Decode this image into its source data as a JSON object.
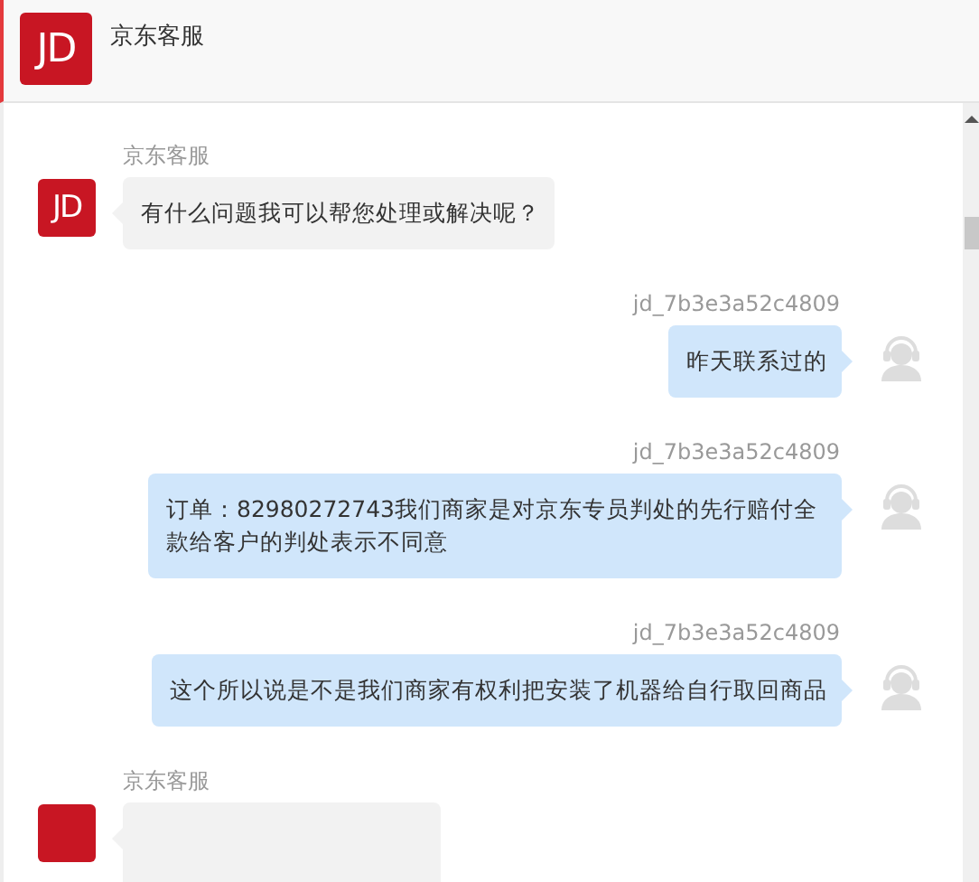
{
  "header": {
    "logo": "JD",
    "title": "京东客服"
  },
  "messages": [
    {
      "kind": "agent",
      "sender": "京东客服",
      "avatar": "JD",
      "text": "有什么问题我可以帮您处理或解决呢？"
    },
    {
      "kind": "user",
      "sender": "jd_7b3e3a52c4809",
      "text": "昨天联系过的"
    },
    {
      "kind": "user",
      "sender": "jd_7b3e3a52c4809",
      "text": "订单：82980272743我们商家是对京东专员判处的先行赔付全款给客户的判处表示不同意"
    },
    {
      "kind": "user",
      "sender": "jd_7b3e3a52c4809",
      "text": "这个所以说是不是我们商家有权利把安装了机器给自行取回商品"
    },
    {
      "kind": "agent",
      "sender": "京东客服"
    }
  ]
}
